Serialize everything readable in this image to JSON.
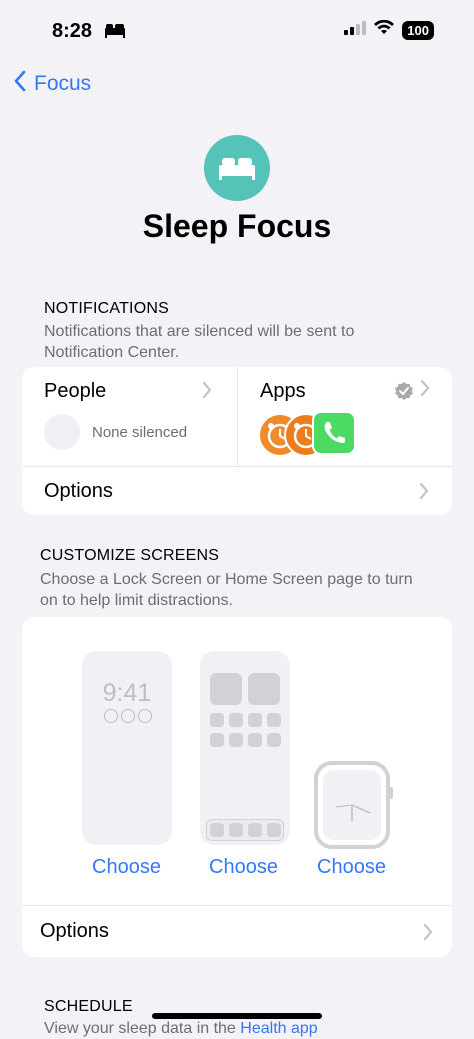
{
  "status": {
    "time": "8:28",
    "battery": "100"
  },
  "nav": {
    "back_label": "Focus"
  },
  "header": {
    "title": "Sleep Focus"
  },
  "notifications": {
    "heading": "NOTIFICATIONS",
    "subtitle_line1": "Notifications that are silenced will be sent to",
    "subtitle_line2": "Notification Center.",
    "people": {
      "label": "People",
      "status": "None silenced"
    },
    "apps": {
      "label": "Apps"
    },
    "options_label": "Options"
  },
  "customize": {
    "heading": "CUSTOMIZE SCREENS",
    "subtitle_line1": "Choose a Lock Screen or Home Screen page to turn",
    "subtitle_line2": "on to help limit distractions.",
    "lock_time": "9:41",
    "choose_labels": [
      "Choose",
      "Choose",
      "Choose"
    ],
    "options_label": "Options"
  },
  "schedule": {
    "heading": "SCHEDULE",
    "subtitle_partial": "View your sleep data in the",
    "subtitle_link": "Health app"
  },
  "colors": {
    "accent": "#3478F6",
    "sleep_teal": "#55C3B8",
    "background": "#F2F2F7"
  }
}
